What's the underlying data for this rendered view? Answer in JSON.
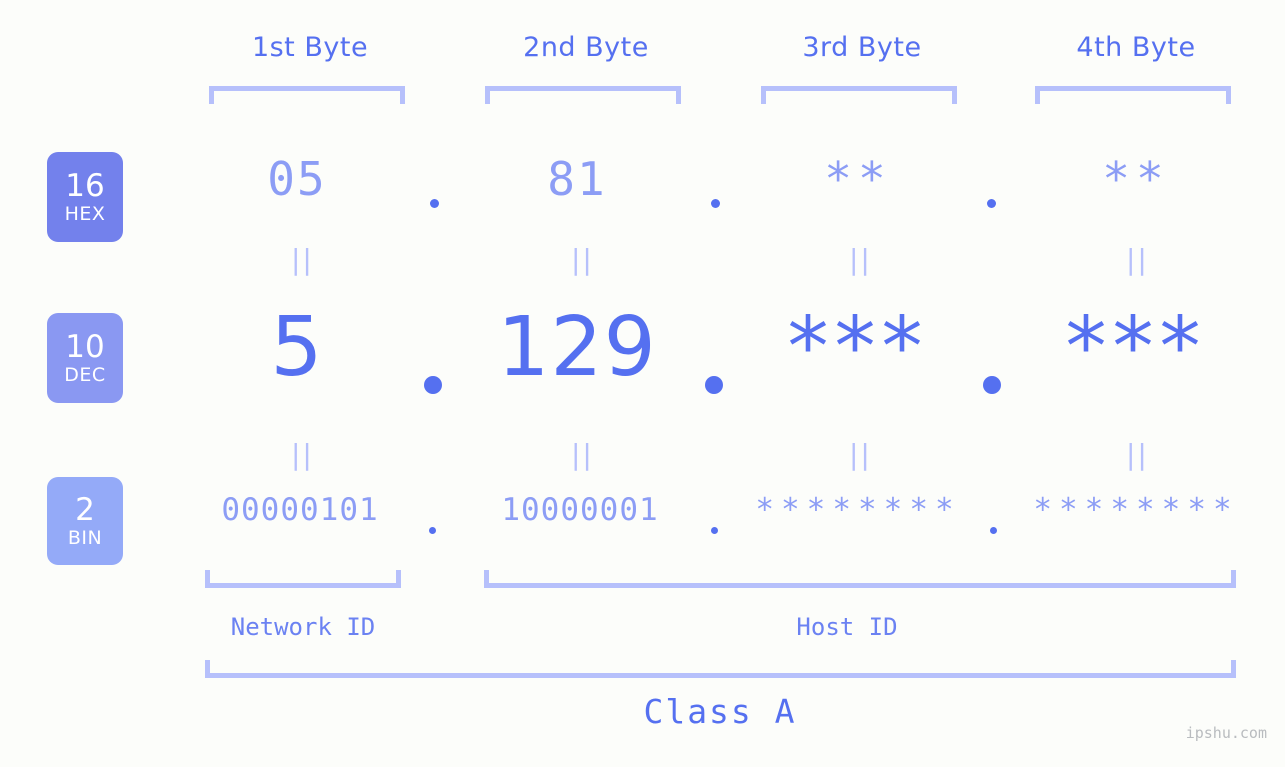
{
  "meta": {
    "background_color": "#fcfdfa",
    "accent_strong": "#5570f0",
    "accent_light": "#8c9df5",
    "accent_pale": "#b6c0fb"
  },
  "header": {
    "byte_labels": [
      {
        "text": "1st Byte"
      },
      {
        "text": "2nd Byte"
      },
      {
        "text": "3rd Byte"
      },
      {
        "text": "4th Byte"
      }
    ]
  },
  "badges": [
    {
      "num": "16",
      "name": "HEX",
      "color": "#7381ec"
    },
    {
      "num": "10",
      "name": "DEC",
      "color": "#8a98f2"
    },
    {
      "num": "2",
      "name": "BIN",
      "color": "#94aaf8"
    }
  ],
  "rows": {
    "hex": {
      "base": "16",
      "base_name": "HEX",
      "values": [
        "05",
        "81",
        "**",
        "**"
      ]
    },
    "dec": {
      "base": "10",
      "base_name": "DEC",
      "values": [
        "5",
        "129",
        "***",
        "***"
      ]
    },
    "bin": {
      "base": "2",
      "base_name": "BIN",
      "values": [
        "00000101",
        "10000001",
        "********",
        "********"
      ]
    }
  },
  "separators": {
    "glyph": "dot",
    "count_per_row": 3
  },
  "equals_marker": {
    "glyph": "=",
    "rendered": "||",
    "rows_between": [
      "hex-dec",
      "dec-bin"
    ],
    "count_per_gap": 4
  },
  "sections": [
    {
      "label": "Network ID",
      "span": "1st Byte"
    },
    {
      "label": "Host ID",
      "span": "2nd-4th Byte"
    }
  ],
  "class": {
    "label": "Class A"
  },
  "watermark": {
    "text": "ipshu.com"
  }
}
